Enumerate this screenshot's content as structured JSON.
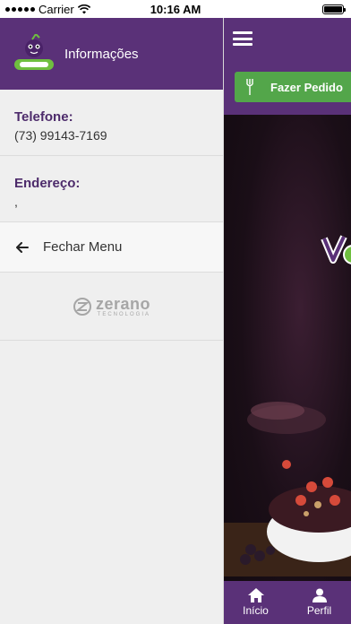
{
  "status_bar": {
    "carrier": "Carrier",
    "time": "10:16 AM"
  },
  "drawer": {
    "title": "Informações",
    "phone": {
      "label": "Telefone:",
      "value": "(73) 99143-7169"
    },
    "address": {
      "label": "Endereço:",
      "value": ","
    },
    "close_menu_label": "Fechar Menu",
    "brand": {
      "name": "zerano",
      "tagline": "TECNOLOGIA"
    }
  },
  "main": {
    "order_button_label": "Fazer Pedido",
    "nav": [
      {
        "label": "Início",
        "icon": "home-icon"
      },
      {
        "label": "Perfil",
        "icon": "user-icon"
      }
    ]
  },
  "colors": {
    "primary": "#5a3178",
    "accent_green": "#53a64a",
    "label_purple": "#4d2b6b"
  }
}
